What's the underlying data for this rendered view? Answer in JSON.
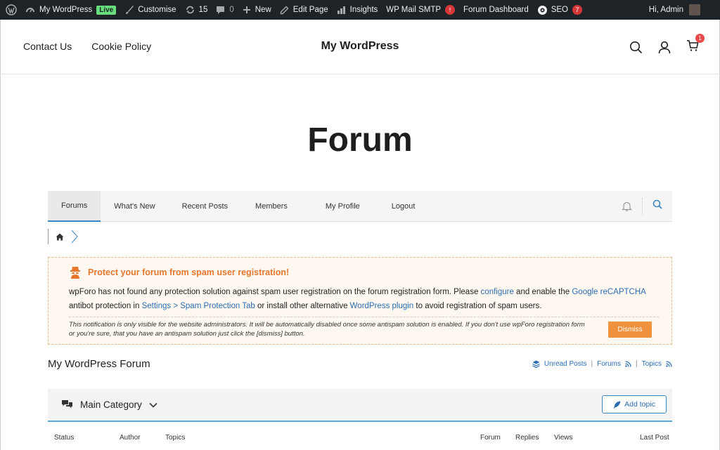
{
  "adminbar": {
    "site_name": "My WordPress",
    "live_badge": "Live",
    "customise": "Customise",
    "updates_count": "15",
    "comments_count": "0",
    "new_label": "New",
    "edit_page": "Edit Page",
    "insights": "Insights",
    "wp_mail_smtp": "WP Mail SMTP",
    "wp_mail_badge": "!",
    "forum_dashboard": "Forum Dashboard",
    "seo": "SEO",
    "seo_badge": "7",
    "greeting": "Hi, Admin"
  },
  "header": {
    "nav": [
      "Contact Us",
      "Cookie Policy"
    ],
    "site_title": "My WordPress",
    "cart_count": "1"
  },
  "page": {
    "title": "Forum"
  },
  "forum_menu": {
    "tabs": [
      "Forums",
      "What's New",
      "Recent Posts",
      "Members",
      "My Profile",
      "Logout"
    ],
    "active_tab": "Forums"
  },
  "notice": {
    "title": "Protect your forum from spam user registration!",
    "text_1": "wpForo has not found any protection solution against spam user registration on the forum registration form. Please ",
    "link_configure": "configure",
    "text_2": " and enable the ",
    "link_recaptcha": "Google reCAPTCHA",
    "text_3": " antibot protection in ",
    "link_settings": "Settings > Spam Protection Tab",
    "text_4": " or install other alternative ",
    "link_plugin": "WordPress plugin",
    "text_5": " to avoid registration of spam users.",
    "small_note": "This notification is only visible for the website administrators. It will be automatically disabled once some antispam solution is enabled. If you don't use wpForo registration form or you're sure, that you have an antispam solution just click the [dismiss] button.",
    "dismiss": "Dismiss"
  },
  "forum": {
    "title": "My WordPress Forum",
    "unread_posts": "Unread Posts",
    "forums_link": "Forums",
    "topics_link": "Topics",
    "category": "Main Category",
    "add_topic": "Add topic",
    "columns": [
      "Status",
      "Author",
      "Topics",
      "Forum",
      "Replies",
      "Views",
      "Last Post"
    ]
  },
  "colors": {
    "adminbar_bg": "#1d2327",
    "accent_blue": "#3a87c9",
    "notice_orange": "#e8772e",
    "dismiss_bg": "#f0913e"
  }
}
